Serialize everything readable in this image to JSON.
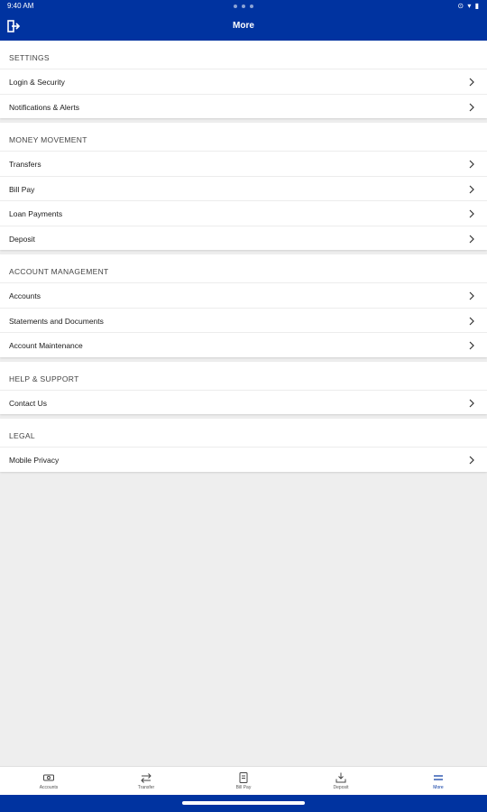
{
  "status_bar": {
    "time": "9:40 AM",
    "icons": "⊙ ▾ ▮"
  },
  "app_bar": {
    "title": "More",
    "logout_icon": "logout-icon"
  },
  "sections": [
    {
      "header": "SETTINGS",
      "items": [
        "Login & Security",
        "Notifications & Alerts"
      ]
    },
    {
      "header": "MONEY MOVEMENT",
      "items": [
        "Transfers",
        "Bill Pay",
        "Loan Payments",
        "Deposit"
      ]
    },
    {
      "header": "ACCOUNT MANAGEMENT",
      "items": [
        "Accounts",
        "Statements and Documents",
        "Account Maintenance"
      ]
    },
    {
      "header": "HELP & SUPPORT",
      "items": [
        "Contact Us"
      ]
    },
    {
      "header": "LEGAL",
      "items": [
        "Mobile Privacy"
      ]
    }
  ],
  "bottom_nav": [
    {
      "label": "Accounts",
      "icon": "accounts-icon"
    },
    {
      "label": "Transfer",
      "icon": "transfer-icon"
    },
    {
      "label": "Bill Pay",
      "icon": "bill-pay-icon"
    },
    {
      "label": "Deposit",
      "icon": "deposit-icon"
    },
    {
      "label": "More",
      "icon": "more-icon",
      "active": true
    }
  ],
  "colors": {
    "brand": "#0033a0",
    "background": "#eeeeee"
  }
}
